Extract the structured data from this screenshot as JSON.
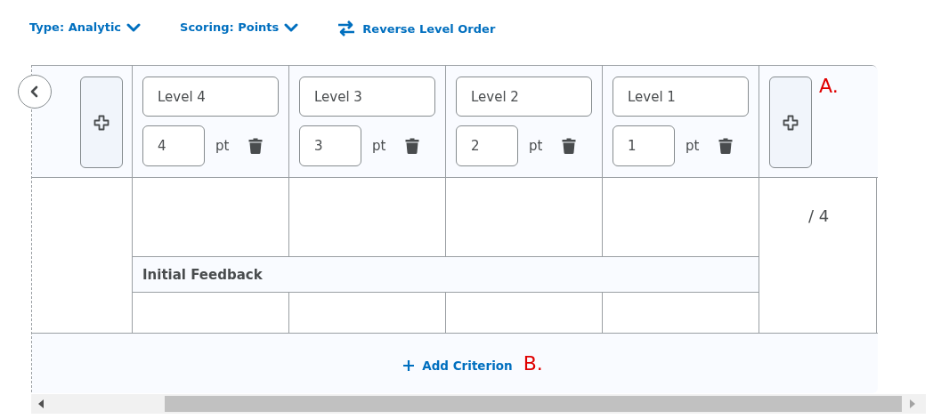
{
  "toolbar": [
    {
      "kind": "dropdown",
      "label": "Type: Analytic"
    },
    {
      "kind": "dropdown",
      "label": "Scoring: Points"
    },
    {
      "kind": "reverse",
      "label": "Reverse Level Order"
    }
  ],
  "levels": [
    {
      "name": "Level 4",
      "points": "4",
      "unit": "pt"
    },
    {
      "name": "Level 3",
      "points": "3",
      "unit": "pt"
    },
    {
      "name": "Level 2",
      "points": "2",
      "unit": "pt"
    },
    {
      "name": "Level 1",
      "points": "1",
      "unit": "pt"
    }
  ],
  "total": "/ 4",
  "feedback_label": "Initial Feedback",
  "add_criterion": "Add Criterion",
  "annotations": [
    "A.",
    "B."
  ]
}
